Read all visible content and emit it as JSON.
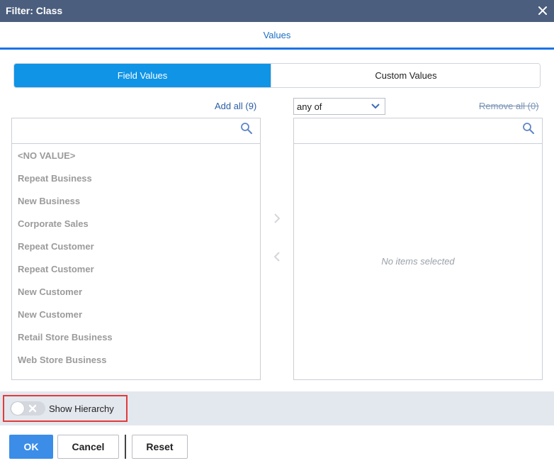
{
  "dialog": {
    "title": "Filter: Class",
    "close_icon": "close-icon"
  },
  "tabs": {
    "active": "Values"
  },
  "segmented": {
    "field_values": "Field Values",
    "custom_values": "Custom Values",
    "active_color": "#0f94e6"
  },
  "left": {
    "add_all": "Add all (9)",
    "search_placeholder": "",
    "items": [
      "<NO VALUE>",
      "Repeat Business",
      "New Business",
      "Corporate Sales",
      "Repeat Customer",
      "Repeat Customer",
      "New Customer",
      "New Customer",
      "Retail Store Business",
      "Web Store Business"
    ]
  },
  "right": {
    "match_mode": "any of",
    "remove_all": "Remove all (0)",
    "search_placeholder": "",
    "empty_text": "No items selected"
  },
  "hierarchy": {
    "label": "Show Hierarchy",
    "enabled": false,
    "highlight_color": "#e23b3b"
  },
  "footer": {
    "ok": "OK",
    "cancel": "Cancel",
    "reset": "Reset",
    "primary_color": "#3b8de8"
  }
}
